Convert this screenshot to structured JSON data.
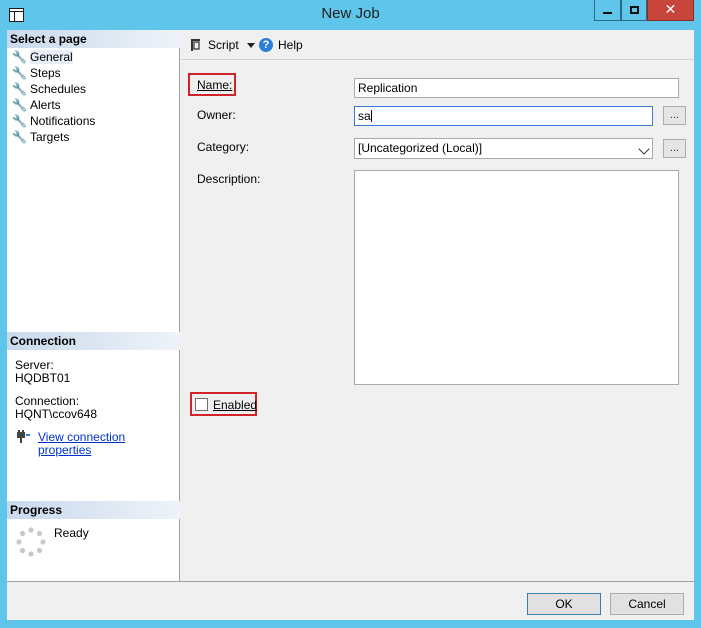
{
  "window": {
    "title": "New Job",
    "close_glyph": "✕"
  },
  "left": {
    "select_page_header": "Select a page",
    "pages": [
      "General",
      "Steps",
      "Schedules",
      "Alerts",
      "Notifications",
      "Targets"
    ],
    "selected_page": "General",
    "connection_header": "Connection",
    "server_label": "Server:",
    "server_value": "HQDBT01",
    "connection_label": "Connection:",
    "connection_value": "HQNT\\ccov648",
    "view_connection_link": "View connection properties",
    "progress_header": "Progress",
    "progress_status": "Ready"
  },
  "toolbar": {
    "script_label": "Script",
    "help_label": "Help"
  },
  "form": {
    "name_label": "Name:",
    "name_value": "Replication",
    "owner_label": "Owner:",
    "owner_value": "sa",
    "category_label": "Category:",
    "category_value": "[Uncategorized (Local)]",
    "description_label": "Description:",
    "description_value": "",
    "enabled_label": "Enabled",
    "enabled_checked": false,
    "browse_label": "..."
  },
  "buttons": {
    "ok_label": "OK",
    "cancel_label": "Cancel"
  },
  "colors": {
    "titlebar": "#60c5ea",
    "highlight_box": "#d1232a",
    "link": "#0033cc"
  }
}
